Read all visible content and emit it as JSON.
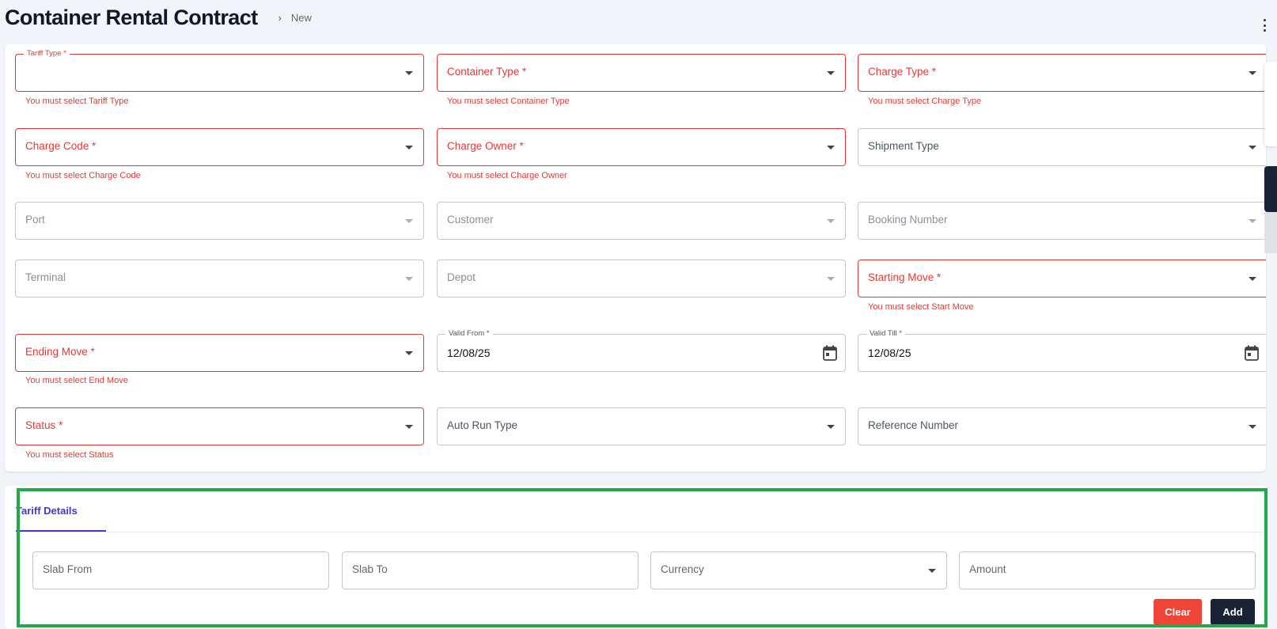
{
  "header": {
    "title": "Container Rental Contract",
    "breadcrumb_sep": "›",
    "breadcrumb_current": "New"
  },
  "form": {
    "tariff_type": {
      "label": "Tariff Type *",
      "error": "You must select Tariff Type"
    },
    "container_type": {
      "label": "Container Type *",
      "error": "You must select Container Type"
    },
    "charge_type": {
      "label": "Charge Type *",
      "error": "You must select Charge Type"
    },
    "charge_code": {
      "label": "Charge Code *",
      "error": "You must select Charge Code"
    },
    "charge_owner": {
      "label": "Charge Owner *",
      "error": "You must select Charge Owner"
    },
    "shipment_type": {
      "label": "Shipment Type"
    },
    "port": {
      "label": "Port"
    },
    "customer": {
      "label": "Customer"
    },
    "booking_number": {
      "label": "Booking Number"
    },
    "terminal": {
      "label": "Terminal"
    },
    "depot": {
      "label": "Depot"
    },
    "starting_move": {
      "label": "Starting Move *",
      "error": "You must select Start Move"
    },
    "ending_move": {
      "label": "Ending Move *",
      "error": "You must select End Move"
    },
    "valid_from": {
      "label": "Valid From *",
      "value": "12/08/25"
    },
    "valid_till": {
      "label": "Valid Till *",
      "value": "12/08/25"
    },
    "status": {
      "label": "Status *",
      "error": "You must select Status"
    },
    "auto_run_type": {
      "label": "Auto Run Type"
    },
    "reference_number": {
      "label": "Reference Number"
    }
  },
  "tariff": {
    "tab_label": "Tariff Details",
    "slab_from": "Slab From",
    "slab_to": "Slab To",
    "currency": "Currency",
    "amount": "Amount",
    "clear_label": "Clear",
    "add_label": "Add"
  },
  "colors": {
    "error": "#e53935",
    "accent": "#4338ca",
    "clear_button": "#f04438",
    "add_button": "#1a2336",
    "highlight": "#22a94a"
  }
}
